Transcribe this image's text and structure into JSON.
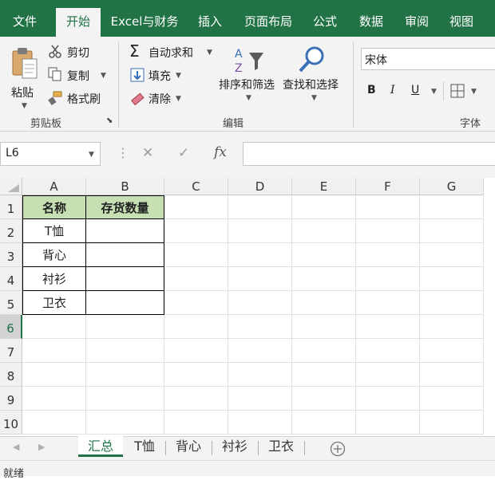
{
  "menu": {
    "tabs": [
      "文件",
      "开始",
      "Excel与财务",
      "插入",
      "页面布局",
      "公式",
      "数据",
      "审阅",
      "视图"
    ],
    "active_index": 1
  },
  "ribbon": {
    "clipboard": {
      "paste": "粘贴",
      "cut": "剪切",
      "copy": "复制",
      "format_painter": "格式刷",
      "group_label": "剪贴板"
    },
    "editing": {
      "autosum": "自动求和",
      "fill": "填充",
      "clear": "清除",
      "sort_filter": "排序和筛选",
      "find_select": "查找和选择",
      "group_label": "编辑"
    },
    "font": {
      "font_name": "宋体",
      "bold": "B",
      "italic": "I",
      "underline": "U",
      "group_label": "字体"
    }
  },
  "formula_bar": {
    "name_box": "L6",
    "cancel": "✕",
    "enter": "✓",
    "fx": "fx",
    "formula": ""
  },
  "grid": {
    "columns": [
      "A",
      "B",
      "C",
      "D",
      "E",
      "F",
      "G"
    ],
    "rows": [
      "1",
      "2",
      "3",
      "4",
      "5",
      "6",
      "7",
      "8",
      "9",
      "10"
    ],
    "selected_row": "6",
    "header_fill": "#c6e0b4",
    "table": {
      "headers": [
        "名称",
        "存货数量"
      ],
      "rows": [
        [
          "T恤",
          ""
        ],
        [
          "背心",
          ""
        ],
        [
          "衬衫",
          ""
        ],
        [
          "卫衣",
          ""
        ]
      ]
    }
  },
  "sheets": {
    "tabs": [
      "汇总",
      "T恤",
      "背心",
      "衬衫",
      "卫衣"
    ],
    "active_index": 0
  },
  "status": {
    "text": "就绪"
  },
  "colors": {
    "accent": "#217346",
    "ribbon_bg": "#f3f3f3"
  }
}
